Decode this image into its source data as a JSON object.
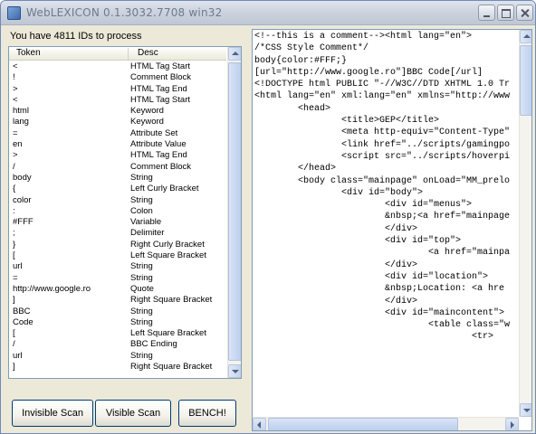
{
  "window": {
    "title": "WebLEXICON 0.1.3032.7708 win32",
    "buttons": [
      "minimize",
      "maximize",
      "close"
    ]
  },
  "status": "You have 4811 IDs to process",
  "table": {
    "columns": [
      "Token",
      "Desc"
    ],
    "rows": [
      {
        "token": "<",
        "desc": "HTML Tag Start"
      },
      {
        "token": "!",
        "desc": "Comment Block"
      },
      {
        "token": ">",
        "desc": "HTML Tag End"
      },
      {
        "token": "<",
        "desc": "HTML Tag Start"
      },
      {
        "token": "html",
        "desc": "Keyword"
      },
      {
        "token": "lang",
        "desc": "Keyword"
      },
      {
        "token": "=",
        "desc": "Attribute Set"
      },
      {
        "token": "en",
        "desc": "Attribute Value"
      },
      {
        "token": ">",
        "desc": "HTML Tag End"
      },
      {
        "token": "/",
        "desc": "Comment Block"
      },
      {
        "token": "body",
        "desc": "String"
      },
      {
        "token": "{",
        "desc": "Left Curly Bracket"
      },
      {
        "token": "color",
        "desc": "String"
      },
      {
        "token": ":",
        "desc": "Colon"
      },
      {
        "token": "#FFF",
        "desc": "Variable"
      },
      {
        "token": ";",
        "desc": "Delimiter"
      },
      {
        "token": "}",
        "desc": "Right Curly Bracket"
      },
      {
        "token": "[",
        "desc": "Left Square Bracket"
      },
      {
        "token": "url",
        "desc": "String"
      },
      {
        "token": "=",
        "desc": "String"
      },
      {
        "token": "http://www.google.ro",
        "desc": "Quote"
      },
      {
        "token": "]",
        "desc": "Right Square Bracket"
      },
      {
        "token": "BBC",
        "desc": "String"
      },
      {
        "token": "Code",
        "desc": "String"
      },
      {
        "token": "[",
        "desc": "Left Square Bracket"
      },
      {
        "token": "/",
        "desc": "BBC Ending"
      },
      {
        "token": "url",
        "desc": "String"
      },
      {
        "token": "]",
        "desc": "Right Square Bracket"
      }
    ]
  },
  "buttons": {
    "invisible_scan": "Invisible Scan",
    "visible_scan": "Visible Scan",
    "bench": "BENCH!"
  },
  "code_lines": [
    "<!--this is a comment--><html lang=\"en\">",
    "/*CSS Style Comment*/",
    "body{color:#FFF;}",
    "[url=\"http://www.google.ro\"]BBC Code[/url]",
    "<!DOCTYPE html PUBLIC \"-//W3C//DTD XHTML 1.0 Tr",
    "<html lang=\"en\" xml:lang=\"en\" xmlns=\"http://www",
    "        <head>",
    "                <title>GEP</title>",
    "                <meta http-equiv=\"Content-Type\"",
    "                <link href=\"../scripts/gamingpo",
    "                <script src=\"../scripts/hoverpi",
    "        </head>",
    "        <body class=\"mainpage\" onLoad=\"MM_prelo",
    "                <div id=\"body\">",
    "                        <div id=\"menus\">",
    "                        &nbsp;<a href=\"mainpage",
    "                        </div>",
    "                        <div id=\"top\">",
    "                                <a href=\"mainpa",
    "                        </div>",
    "                        <div id=\"location\">",
    "                        &nbsp;Location: <a hre",
    "                        </div>",
    "                        <div id=\"maincontent\">",
    "                                <table class=\"w",
    "                                        <tr>"
  ]
}
